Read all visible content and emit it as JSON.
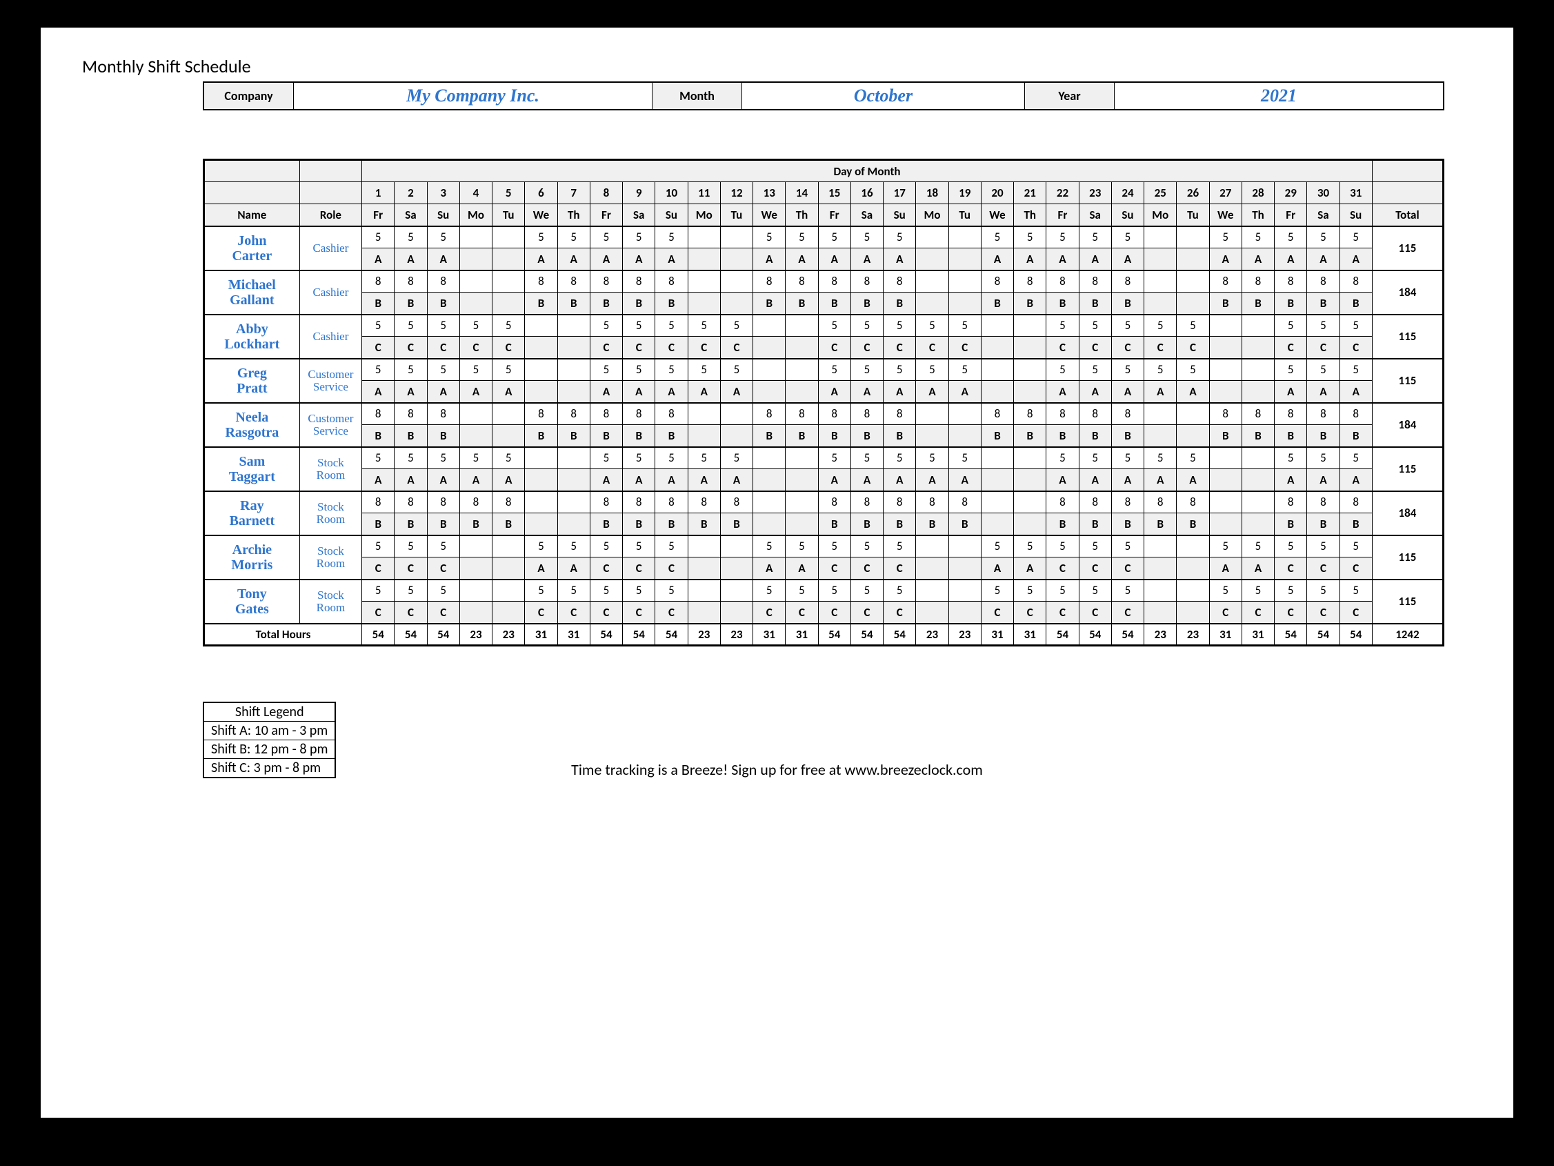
{
  "title": "Monthly Shift Schedule",
  "header": {
    "company_label": "Company",
    "company": "My Company Inc.",
    "month_label": "Month",
    "month": "October",
    "year_label": "Year",
    "year": "2021"
  },
  "day_of_month_label": "Day of Month",
  "col_name": "Name",
  "col_role": "Role",
  "col_total": "Total",
  "days": [
    "1",
    "2",
    "3",
    "4",
    "5",
    "6",
    "7",
    "8",
    "9",
    "10",
    "11",
    "12",
    "13",
    "14",
    "15",
    "16",
    "17",
    "18",
    "19",
    "20",
    "21",
    "22",
    "23",
    "24",
    "25",
    "26",
    "27",
    "28",
    "29",
    "30",
    "31"
  ],
  "weekdays": [
    "Fr",
    "Sa",
    "Su",
    "Mo",
    "Tu",
    "We",
    "Th",
    "Fr",
    "Sa",
    "Su",
    "Mo",
    "Tu",
    "We",
    "Th",
    "Fr",
    "Sa",
    "Su",
    "Mo",
    "Tu",
    "We",
    "Th",
    "Fr",
    "Sa",
    "Su",
    "Mo",
    "Tu",
    "We",
    "Th",
    "Fr",
    "Sa",
    "Su"
  ],
  "employees": [
    {
      "name": "John Carter",
      "role": "Cashier",
      "hours": [
        "5",
        "5",
        "5",
        "",
        "",
        "5",
        "5",
        "5",
        "5",
        "5",
        "",
        "",
        "5",
        "5",
        "5",
        "5",
        "5",
        "",
        "",
        "5",
        "5",
        "5",
        "5",
        "5",
        "",
        "",
        "5",
        "5",
        "5",
        "5",
        "5"
      ],
      "shifts": [
        "A",
        "A",
        "A",
        "",
        "",
        "A",
        "A",
        "A",
        "A",
        "A",
        "",
        "",
        "A",
        "A",
        "A",
        "A",
        "A",
        "",
        "",
        "A",
        "A",
        "A",
        "A",
        "A",
        "",
        "",
        "A",
        "A",
        "A",
        "A",
        "A"
      ],
      "total": "115"
    },
    {
      "name": "Michael Gallant",
      "role": "Cashier",
      "hours": [
        "8",
        "8",
        "8",
        "",
        "",
        "8",
        "8",
        "8",
        "8",
        "8",
        "",
        "",
        "8",
        "8",
        "8",
        "8",
        "8",
        "",
        "",
        "8",
        "8",
        "8",
        "8",
        "8",
        "",
        "",
        "8",
        "8",
        "8",
        "8",
        "8"
      ],
      "shifts": [
        "B",
        "B",
        "B",
        "",
        "",
        "B",
        "B",
        "B",
        "B",
        "B",
        "",
        "",
        "B",
        "B",
        "B",
        "B",
        "B",
        "",
        "",
        "B",
        "B",
        "B",
        "B",
        "B",
        "",
        "",
        "B",
        "B",
        "B",
        "B",
        "B"
      ],
      "total": "184"
    },
    {
      "name": "Abby Lockhart",
      "role": "Cashier",
      "hours": [
        "5",
        "5",
        "5",
        "5",
        "5",
        "",
        "",
        "5",
        "5",
        "5",
        "5",
        "5",
        "",
        "",
        "5",
        "5",
        "5",
        "5",
        "5",
        "",
        "",
        "5",
        "5",
        "5",
        "5",
        "5",
        "",
        "",
        "5",
        "5",
        "5"
      ],
      "shifts": [
        "C",
        "C",
        "C",
        "C",
        "C",
        "",
        "",
        "C",
        "C",
        "C",
        "C",
        "C",
        "",
        "",
        "C",
        "C",
        "C",
        "C",
        "C",
        "",
        "",
        "C",
        "C",
        "C",
        "C",
        "C",
        "",
        "",
        "C",
        "C",
        "C"
      ],
      "total": "115"
    },
    {
      "name": "Greg Pratt",
      "role": "Customer Service",
      "hours": [
        "5",
        "5",
        "5",
        "5",
        "5",
        "",
        "",
        "5",
        "5",
        "5",
        "5",
        "5",
        "",
        "",
        "5",
        "5",
        "5",
        "5",
        "5",
        "",
        "",
        "5",
        "5",
        "5",
        "5",
        "5",
        "",
        "",
        "5",
        "5",
        "5"
      ],
      "shifts": [
        "A",
        "A",
        "A",
        "A",
        "A",
        "",
        "",
        "A",
        "A",
        "A",
        "A",
        "A",
        "",
        "",
        "A",
        "A",
        "A",
        "A",
        "A",
        "",
        "",
        "A",
        "A",
        "A",
        "A",
        "A",
        "",
        "",
        "A",
        "A",
        "A"
      ],
      "total": "115"
    },
    {
      "name": "Neela Rasgotra",
      "role": "Customer Service",
      "hours": [
        "8",
        "8",
        "8",
        "",
        "",
        "8",
        "8",
        "8",
        "8",
        "8",
        "",
        "",
        "8",
        "8",
        "8",
        "8",
        "8",
        "",
        "",
        "8",
        "8",
        "8",
        "8",
        "8",
        "",
        "",
        "8",
        "8",
        "8",
        "8",
        "8"
      ],
      "shifts": [
        "B",
        "B",
        "B",
        "",
        "",
        "B",
        "B",
        "B",
        "B",
        "B",
        "",
        "",
        "B",
        "B",
        "B",
        "B",
        "B",
        "",
        "",
        "B",
        "B",
        "B",
        "B",
        "B",
        "",
        "",
        "B",
        "B",
        "B",
        "B",
        "B"
      ],
      "total": "184"
    },
    {
      "name": "Sam Taggart",
      "role": "Stock Room",
      "hours": [
        "5",
        "5",
        "5",
        "5",
        "5",
        "",
        "",
        "5",
        "5",
        "5",
        "5",
        "5",
        "",
        "",
        "5",
        "5",
        "5",
        "5",
        "5",
        "",
        "",
        "5",
        "5",
        "5",
        "5",
        "5",
        "",
        "",
        "5",
        "5",
        "5"
      ],
      "shifts": [
        "A",
        "A",
        "A",
        "A",
        "A",
        "",
        "",
        "A",
        "A",
        "A",
        "A",
        "A",
        "",
        "",
        "A",
        "A",
        "A",
        "A",
        "A",
        "",
        "",
        "A",
        "A",
        "A",
        "A",
        "A",
        "",
        "",
        "A",
        "A",
        "A"
      ],
      "total": "115"
    },
    {
      "name": "Ray Barnett",
      "role": "Stock Room",
      "hours": [
        "8",
        "8",
        "8",
        "8",
        "8",
        "",
        "",
        "8",
        "8",
        "8",
        "8",
        "8",
        "",
        "",
        "8",
        "8",
        "8",
        "8",
        "8",
        "",
        "",
        "8",
        "8",
        "8",
        "8",
        "8",
        "",
        "",
        "8",
        "8",
        "8"
      ],
      "shifts": [
        "B",
        "B",
        "B",
        "B",
        "B",
        "",
        "",
        "B",
        "B",
        "B",
        "B",
        "B",
        "",
        "",
        "B",
        "B",
        "B",
        "B",
        "B",
        "",
        "",
        "B",
        "B",
        "B",
        "B",
        "B",
        "",
        "",
        "B",
        "B",
        "B"
      ],
      "total": "184"
    },
    {
      "name": "Archie Morris",
      "role": "Stock Room",
      "hours": [
        "5",
        "5",
        "5",
        "",
        "",
        "5",
        "5",
        "5",
        "5",
        "5",
        "",
        "",
        "5",
        "5",
        "5",
        "5",
        "5",
        "",
        "",
        "5",
        "5",
        "5",
        "5",
        "5",
        "",
        "",
        "5",
        "5",
        "5",
        "5",
        "5"
      ],
      "shifts": [
        "C",
        "C",
        "C",
        "",
        "",
        "A",
        "A",
        "C",
        "C",
        "C",
        "",
        "",
        "A",
        "A",
        "C",
        "C",
        "C",
        "",
        "",
        "A",
        "A",
        "C",
        "C",
        "C",
        "",
        "",
        "A",
        "A",
        "C",
        "C",
        "C"
      ],
      "total": "115"
    },
    {
      "name": "Tony Gates",
      "role": "Stock Room",
      "hours": [
        "5",
        "5",
        "5",
        "",
        "",
        "5",
        "5",
        "5",
        "5",
        "5",
        "",
        "",
        "5",
        "5",
        "5",
        "5",
        "5",
        "",
        "",
        "5",
        "5",
        "5",
        "5",
        "5",
        "",
        "",
        "5",
        "5",
        "5",
        "5",
        "5"
      ],
      "shifts": [
        "C",
        "C",
        "C",
        "",
        "",
        "C",
        "C",
        "C",
        "C",
        "C",
        "",
        "",
        "C",
        "C",
        "C",
        "C",
        "C",
        "",
        "",
        "C",
        "C",
        "C",
        "C",
        "C",
        "",
        "",
        "C",
        "C",
        "C",
        "C",
        "C"
      ],
      "total": "115"
    }
  ],
  "total_hours_label": "Total Hours",
  "totals_row": [
    "54",
    "54",
    "54",
    "23",
    "23",
    "31",
    "31",
    "54",
    "54",
    "54",
    "23",
    "23",
    "31",
    "31",
    "54",
    "54",
    "54",
    "23",
    "23",
    "31",
    "31",
    "54",
    "54",
    "54",
    "23",
    "23",
    "31",
    "31",
    "54",
    "54",
    "54"
  ],
  "grand_total": "1242",
  "legend": {
    "title": "Shift Legend",
    "rows": [
      "Shift A: 10 am - 3 pm",
      "Shift B: 12 pm - 8 pm",
      "Shift C: 3 pm - 8 pm"
    ]
  },
  "footer": "Time tracking is a Breeze! Sign up for free at www.breezeclock.com"
}
